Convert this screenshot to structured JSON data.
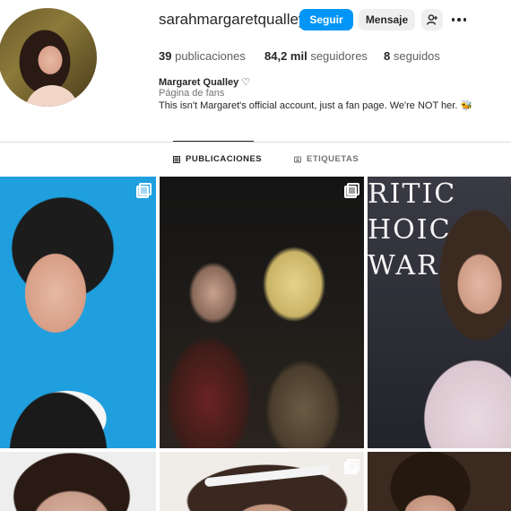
{
  "profile": {
    "username": "sarahmargaretqualley",
    "follow_label": "Seguir",
    "message_label": "Mensaje",
    "add_user_icon": "add-user-icon",
    "more_icon": "more-options-icon",
    "full_name": "Margaret Qualley ♡",
    "category": "Página de fans",
    "bio": "This isn't Margaret's official account, just a fan page. We're NOT her. 🐝"
  },
  "stats": {
    "posts_count": "39",
    "posts_label": "publicaciones",
    "followers_count": "84,2 mil",
    "followers_label": "seguidores",
    "following_count": "8",
    "following_label": "seguidos"
  },
  "tabs": [
    {
      "label": "PUBLICACIONES",
      "icon": "grid-icon",
      "active": true
    },
    {
      "label": "ETIQUETAS",
      "icon": "tagged-icon",
      "active": false
    }
  ],
  "grid": {
    "tile_3_text": "RITIC\nHOIC\nWAR"
  },
  "colors": {
    "accent": "#0095f6",
    "text": "#262626",
    "muted": "#737373"
  }
}
